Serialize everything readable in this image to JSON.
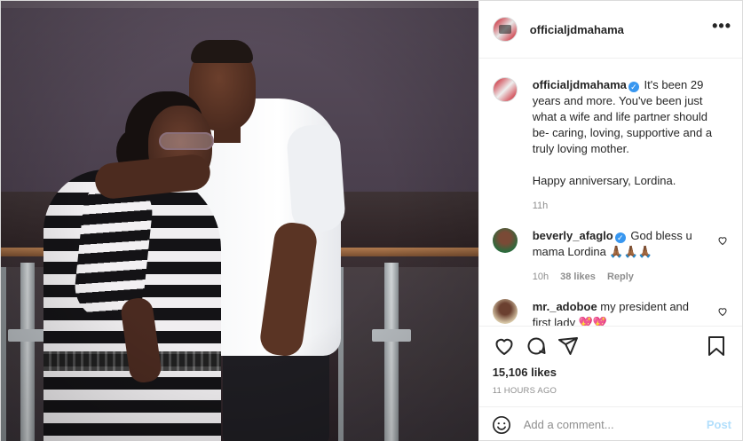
{
  "post": {
    "username": "officialjdmahama",
    "caption_lines": [
      "It's been 29 years and more. You've been just what a wife and life partner should be- caring, loving, supportive and a truly loving mother.",
      "Happy anniversary, Lordina."
    ],
    "caption_age": "11h",
    "likes": "15,106 likes",
    "posted": "11 HOURS AGO"
  },
  "comments": [
    {
      "username": "beverly_afaglo",
      "verified": true,
      "text": "God bless u mama Lordina 🙏🏾🙏🏾🙏🏾",
      "age": "10h",
      "likes": "38 likes",
      "reply": "Reply"
    },
    {
      "username": "mr._adoboe",
      "verified": false,
      "text": "my president and first lady 💖💖"
    }
  ],
  "add_comment": {
    "placeholder": "Add a comment...",
    "post_label": "Post"
  },
  "icons": {
    "more": "more-options-icon",
    "like": "heart-icon",
    "comment": "comment-icon",
    "share": "share-icon",
    "save": "bookmark-icon",
    "emoji": "emoji-icon"
  },
  "colors": {
    "verified": "#3897f0",
    "post_button": "#b2dffc",
    "muted": "#8e8e8e"
  }
}
